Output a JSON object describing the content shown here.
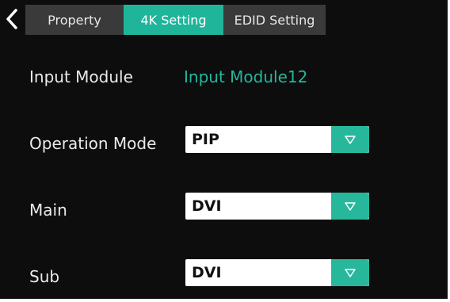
{
  "tabs": [
    {
      "label": "Property",
      "active": false
    },
    {
      "label": "4K Setting",
      "active": true
    },
    {
      "label": "EDID Setting",
      "active": false
    }
  ],
  "input_module": {
    "label": "Input Module",
    "value": "Input Module12"
  },
  "operation_mode": {
    "label": "Operation Mode",
    "value": "PIP"
  },
  "main": {
    "label": "Main",
    "value": "DVI"
  },
  "sub": {
    "label": "Sub",
    "value": "DVI"
  },
  "icons": {
    "back": "chevron-left-icon",
    "dropdown": "triangle-down-icon"
  },
  "colors": {
    "accent": "#1fb59a",
    "background": "#0d0d0d",
    "tab_inactive": "#3a3a3a"
  }
}
